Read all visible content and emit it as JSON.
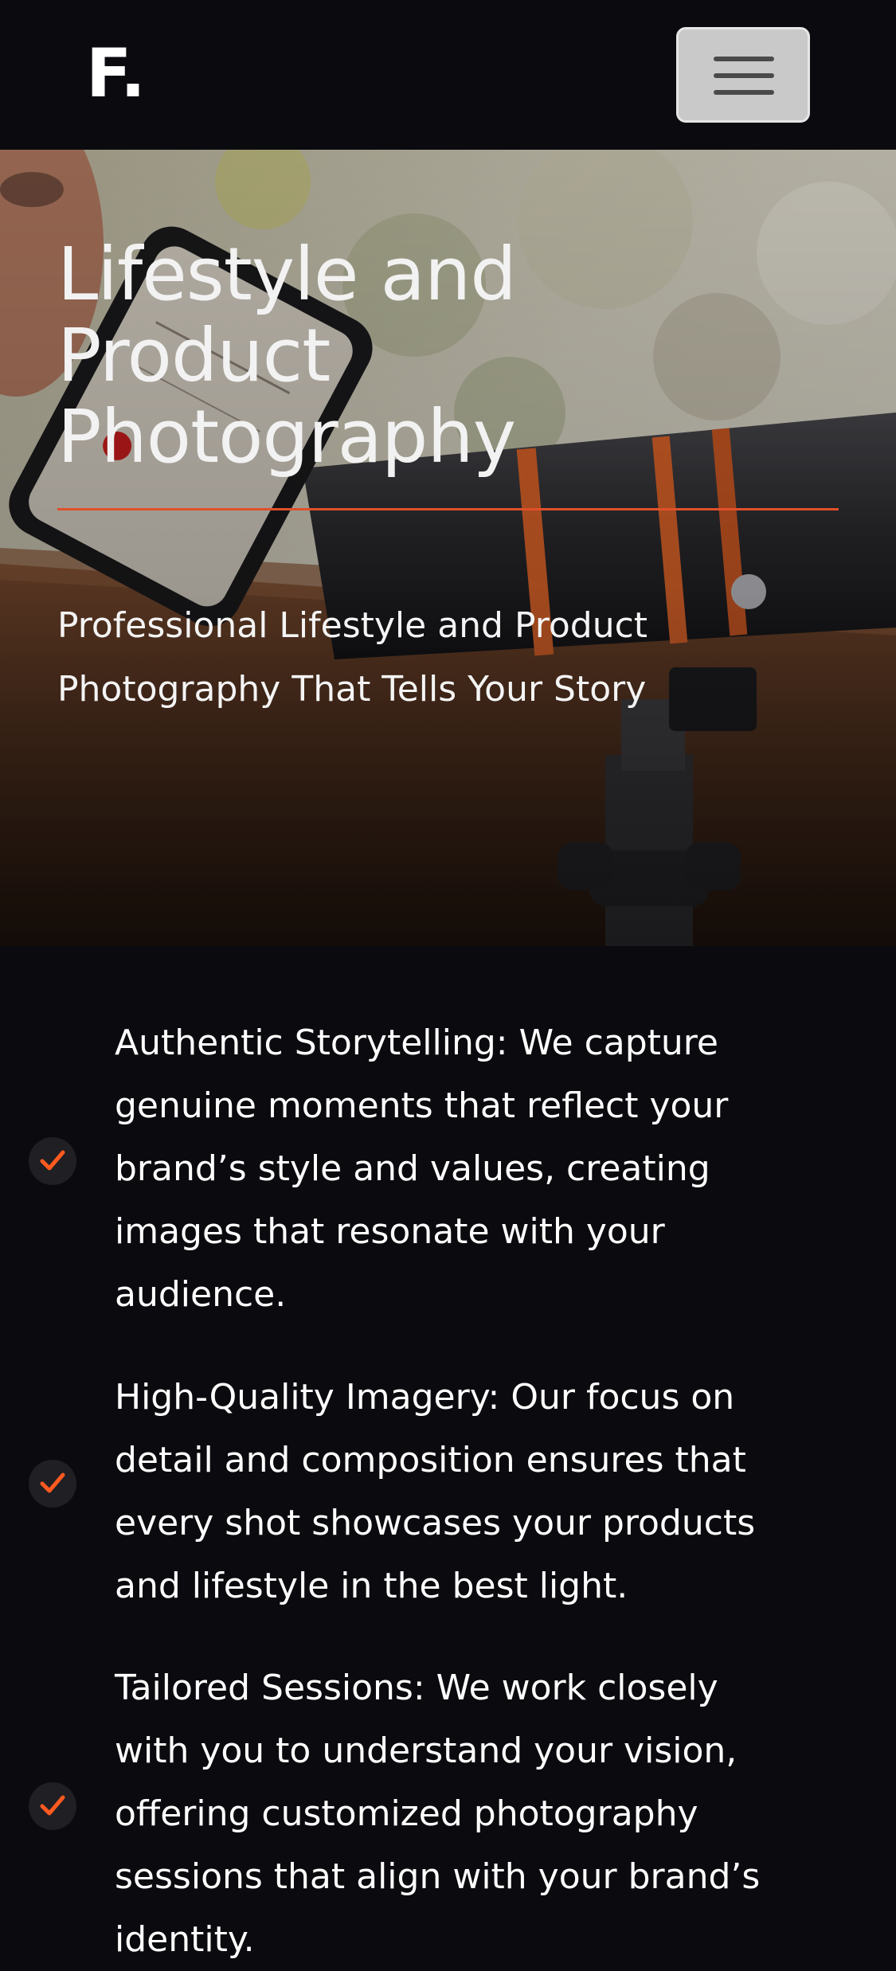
{
  "navbar": {
    "logo": "F.",
    "menu_icon": "hamburger-menu-icon"
  },
  "hero": {
    "title_lines": [
      "Lifestyle and",
      "Product",
      "Photography"
    ],
    "subtitle_lines": [
      "Professional Lifestyle and Product",
      "Photography That Tells Your Story"
    ],
    "background_image": "photographer-looking-through-spotting-scope-with-phone",
    "accent_color": "#e0502a"
  },
  "features": {
    "check_icon": "checkmark-icon",
    "check_color": "#ff5a1f",
    "items": [
      {
        "lines": [
          "Authentic Storytelling: We capture",
          "genuine moments that reflect your",
          "brand’s style and values, creating",
          "images that resonate with your",
          "audience."
        ]
      },
      {
        "lines": [
          "High-Quality Imagery: Our focus on",
          "detail and composition ensures that",
          "every shot showcases your products",
          "and lifestyle in the best light."
        ]
      },
      {
        "lines": [
          "Tailored Sessions: We work closely",
          "with you to understand your vision,",
          "offering customized photography",
          "sessions that align with your brand’s",
          "identity."
        ]
      }
    ]
  }
}
